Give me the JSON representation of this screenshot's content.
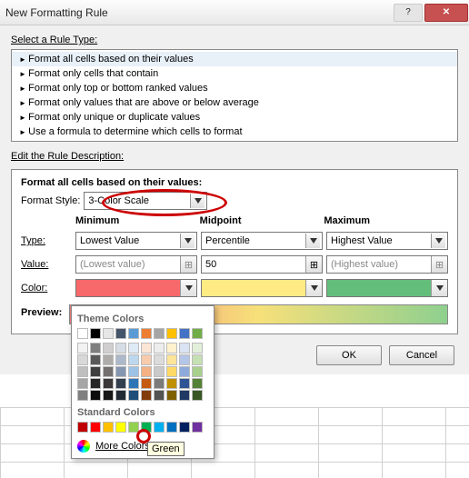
{
  "window": {
    "title": "New Formatting Rule"
  },
  "sections": {
    "select_label": "Select a Rule Type:",
    "desc_label": "Edit the Rule Description:"
  },
  "rule_types": [
    "Format all cells based on their values",
    "Format only cells that contain",
    "Format only top or bottom ranked values",
    "Format only values that are above or below average",
    "Format only unique or duplicate values",
    "Use a formula to determine which cells to format"
  ],
  "edit": {
    "header": "Format all cells based on their values:",
    "style_label": "Format Style:",
    "style_value": "3-Color Scale",
    "columns": {
      "min": {
        "title": "Minimum",
        "type": "Lowest Value",
        "value": "(Lowest value)"
      },
      "mid": {
        "title": "Midpoint",
        "type": "Percentile",
        "value": "50"
      },
      "max": {
        "title": "Maximum",
        "type": "Highest Value",
        "value": "(Highest value)"
      }
    },
    "labels": {
      "type": "Type:",
      "value": "Value:",
      "color": "Color:",
      "preview": "Preview:"
    },
    "swatches": {
      "min": "#f8696b",
      "mid": "#ffeb84",
      "max": "#63be7b"
    }
  },
  "buttons": {
    "ok": "OK",
    "cancel": "Cancel"
  },
  "color_picker": {
    "theme_label": "Theme Colors",
    "standard_label": "Standard Colors",
    "more_label": "More Colors...",
    "tooltip": "Green",
    "theme_row": [
      "#ffffff",
      "#000000",
      "#e7e6e6",
      "#44546a",
      "#5b9bd5",
      "#ed7d31",
      "#a5a5a5",
      "#ffc000",
      "#4472c4",
      "#70ad47"
    ],
    "standard_row": [
      "#c00000",
      "#ff0000",
      "#ffc000",
      "#ffff00",
      "#92d050",
      "#00b050",
      "#00b0f0",
      "#0070c0",
      "#002060",
      "#7030a0"
    ]
  }
}
